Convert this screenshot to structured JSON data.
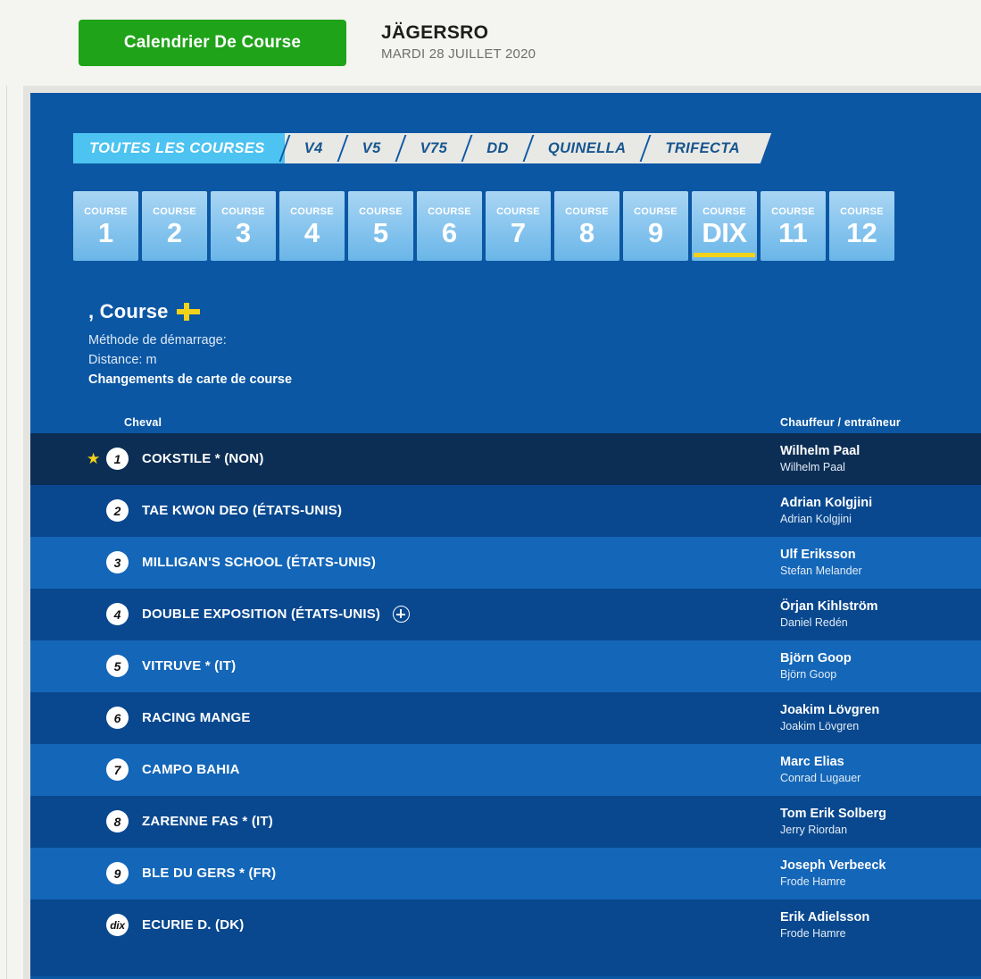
{
  "header": {
    "calendar_button": "Calendrier De Course",
    "track_name": "JÄGERSRO",
    "track_date": "MARDI 28 JUILLET 2020"
  },
  "bet_tabs": [
    {
      "label": "TOUTES LES COURSES",
      "active": true
    },
    {
      "label": "V4",
      "active": false
    },
    {
      "label": "V5",
      "active": false
    },
    {
      "label": "V75",
      "active": false
    },
    {
      "label": "DD",
      "active": false
    },
    {
      "label": "QUINELLA",
      "active": false
    },
    {
      "label": "TRIFECTA",
      "active": false
    }
  ],
  "course_word": "COURSE",
  "courses": [
    {
      "num": "1",
      "selected": false
    },
    {
      "num": "2",
      "selected": false
    },
    {
      "num": "3",
      "selected": false
    },
    {
      "num": "4",
      "selected": false
    },
    {
      "num": "5",
      "selected": false
    },
    {
      "num": "6",
      "selected": false
    },
    {
      "num": "7",
      "selected": false
    },
    {
      "num": "8",
      "selected": false
    },
    {
      "num": "9",
      "selected": false
    },
    {
      "num": "DIX",
      "selected": true
    },
    {
      "num": "11",
      "selected": false
    },
    {
      "num": "12",
      "selected": false
    }
  ],
  "race": {
    "title": ", Course",
    "flag_icon": "swedish-cross-icon",
    "start_method": "Méthode de démarrage:",
    "distance": "Distance: m",
    "changes_link": "Changements de carte de course"
  },
  "startlist": {
    "col_horse": "Cheval",
    "col_driver": "Chauffeur / entraîneur",
    "rows": [
      {
        "num": "1",
        "star": true,
        "horse": "COKSTILE * (NON)",
        "plus": false,
        "driver": "Wilhelm Paal",
        "trainer": "Wilhelm Paal"
      },
      {
        "num": "2",
        "star": false,
        "horse": "TAE KWON DEO (ÉTATS-UNIS)",
        "plus": false,
        "driver": "Adrian Kolgjini",
        "trainer": "Adrian Kolgjini"
      },
      {
        "num": "3",
        "star": false,
        "horse": "MILLIGAN'S SCHOOL (ÉTATS-UNIS)",
        "plus": false,
        "driver": "Ulf Eriksson",
        "trainer": "Stefan Melander"
      },
      {
        "num": "4",
        "star": false,
        "horse": "DOUBLE EXPOSITION (ÉTATS-UNIS)",
        "plus": true,
        "driver": "Örjan Kihlström",
        "trainer": "Daniel Redén"
      },
      {
        "num": "5",
        "star": false,
        "horse": "VITRUVE * (IT)",
        "plus": false,
        "driver": "Björn Goop",
        "trainer": "Björn Goop"
      },
      {
        "num": "6",
        "star": false,
        "horse": "RACING MANGE",
        "plus": false,
        "driver": "Joakim Lövgren",
        "trainer": "Joakim Lövgren"
      },
      {
        "num": "7",
        "star": false,
        "horse": "CAMPO BAHIA",
        "plus": false,
        "driver": "Marc Elias",
        "trainer": "Conrad Lugauer"
      },
      {
        "num": "8",
        "star": false,
        "horse": "ZARENNE FAS * (IT)",
        "plus": false,
        "driver": "Tom Erik Solberg",
        "trainer": "Jerry Riordan"
      },
      {
        "num": "9",
        "star": false,
        "horse": "BLE DU GERS * (FR)",
        "plus": false,
        "driver": "Joseph Verbeeck",
        "trainer": "Frode Hamre"
      },
      {
        "num": "dix",
        "star": false,
        "horse": "ECURIE D. (DK)",
        "plus": false,
        "driver": "Erik Adielsson",
        "trainer": "Frode Hamre"
      }
    ]
  },
  "colors": {
    "panel_blue": "#0b57a4",
    "row_odd": "#1466b8",
    "row_even": "#09488f",
    "row_first": "#0c2e55",
    "accent_yellow": "#f2d21a",
    "active_tab": "#4cc3f0",
    "green_button": "#1fa319"
  }
}
